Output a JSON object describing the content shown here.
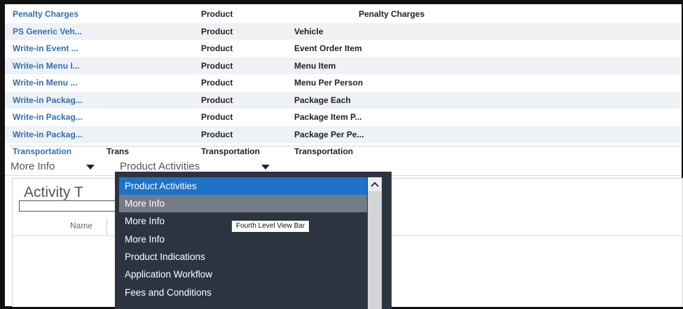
{
  "list": {
    "rows": [
      {
        "name": "Penalty Charges",
        "type": "Product",
        "value": "Penalty Charges",
        "alt": false,
        "centered": true
      },
      {
        "name": "PS Generic Veh...",
        "type": "Product",
        "value": "Vehicle",
        "alt": true
      },
      {
        "name": "Write-in Event ...",
        "type": "Product",
        "value": "Event Order Item",
        "alt": false
      },
      {
        "name": "Write-in Menu I...",
        "type": "Product",
        "value": "Menu Item",
        "alt": true
      },
      {
        "name": "Write-in Menu ...",
        "type": "Product",
        "value": "Menu Per Person",
        "alt": false
      },
      {
        "name": "Write-in Packag...",
        "type": "Product",
        "value": "Package Each",
        "alt": true
      },
      {
        "name": "Write-in Packag...",
        "type": "Product",
        "value": "Package Item P...",
        "alt": false
      },
      {
        "name": "Write-in Packag...",
        "type": "Product",
        "value": "Package Per Pe...",
        "alt": true
      }
    ],
    "last_row": {
      "name": "Transportation",
      "code": "Trans",
      "type": "Transportation",
      "value": "Transportation"
    }
  },
  "viewbar": {
    "item1": "More Info",
    "item2": "Product Activities"
  },
  "panel": {
    "title": "Activity T",
    "column_name": "Name"
  },
  "menu": {
    "items": [
      {
        "label": "Product Activities",
        "state": "selected"
      },
      {
        "label": "More Info",
        "state": "hover"
      },
      {
        "label": "More Info",
        "state": "normal"
      },
      {
        "label": "More Info",
        "state": "normal"
      },
      {
        "label": "Product Indications",
        "state": "normal"
      },
      {
        "label": "Application Workflow",
        "state": "normal"
      },
      {
        "label": "Fees and Conditions",
        "state": "normal"
      }
    ],
    "tooltip": "Fourth Level View Bar"
  },
  "colors": {
    "link": "#2f6fb3",
    "menu_bg": "#2c3442",
    "menu_selected": "#1e72c8",
    "menu_hover": "#747b86"
  }
}
